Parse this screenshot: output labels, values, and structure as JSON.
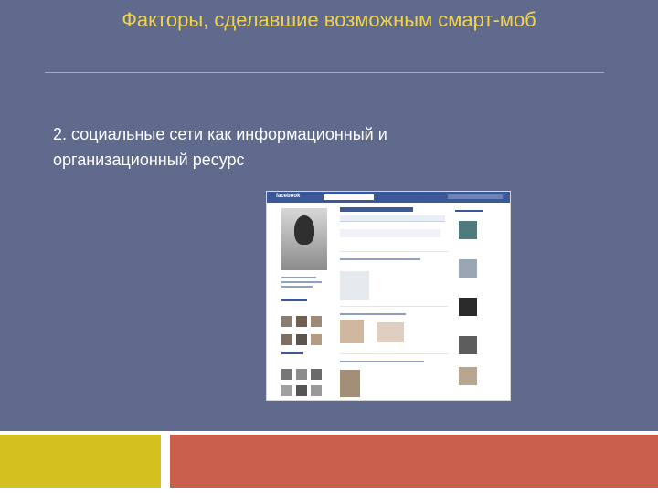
{
  "slide": {
    "title": "Факторы, сделавшие возможным смарт-моб",
    "body_line_1": "2.  социальные сети как информационный и",
    "body_line_2": "организационный ресурс"
  },
  "screenshot": {
    "brand_text": "facebook"
  },
  "colors": {
    "background": "#5f6a8c",
    "title": "#f1d34a",
    "footer_left": "#d4c01f",
    "footer_right": "#ca5f4b"
  }
}
